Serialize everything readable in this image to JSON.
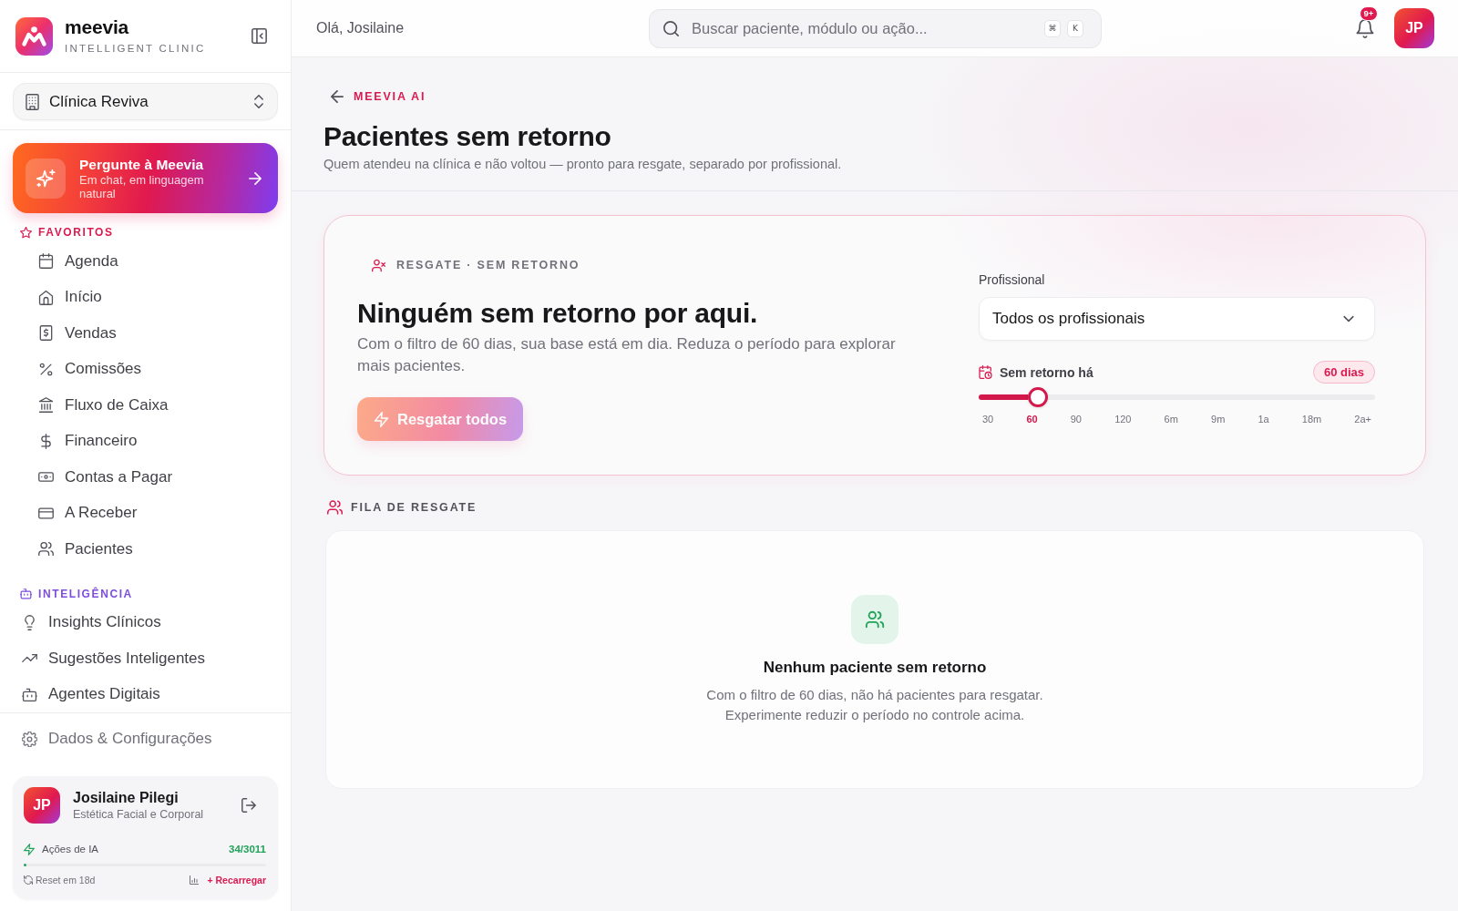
{
  "sidebar": {
    "brand": {
      "name": "meevia",
      "tagline": "INTELLIGENT CLINIC"
    },
    "clinic_selector": {
      "value": "Clínica Reviva"
    },
    "ask_card": {
      "title": "Pergunte à Meevia",
      "subtitle": "Em chat, em linguagem natural"
    },
    "sections": [
      {
        "title": "FAVORITOS",
        "color": "#db1a4f",
        "kind": "indented",
        "items": [
          "Agenda",
          "Início",
          "Vendas",
          "Comissões",
          "Fluxo de Caixa",
          "Financeiro",
          "Contas a Pagar",
          "A Receber",
          "Pacientes"
        ]
      },
      {
        "title": "INTELIGÊNCIA",
        "color": "#7c4ddf",
        "kind": "flat",
        "items": [
          "Insights Clínicos",
          "Sugestões Inteligentes",
          "Agentes Digitais"
        ]
      }
    ],
    "footer_item": "Dados & Configurações",
    "user_card": {
      "initials": "JP",
      "name": "Josilaine Pilegi",
      "role": "Estética Facial e Corporal",
      "usage": {
        "label": "Ações de IA",
        "count": "34/3011",
        "level": 0.011
      },
      "reset": "Reset em 18d",
      "recharge": "+ Recarregar"
    }
  },
  "top_bar": {
    "greeting": "Olá, Josilaine",
    "search": {
      "placeholder": "Buscar paciente, módulo ou ação...",
      "shortcut": [
        "⌘",
        "K"
      ]
    },
    "notification_badge": "9+",
    "avatar": "JP"
  },
  "page_header": {
    "breadcrumb": "MEEVIA AI",
    "title": "Pacientes sem retorno",
    "subtitle": "Quem atendeu na clínica e não voltou — pronto para resgate, separado por profissional."
  },
  "hero": {
    "eyebrow": "RESGATE · SEM RETORNO",
    "heading": "Ninguém sem retorno por aqui.",
    "text": "Com o filtro de 60 dias, sua base está em dia. Reduza o período para explorar mais pacientes.",
    "rescue_button": {
      "label": "Resgatar todos",
      "disabled": true
    },
    "filter": {
      "professional_label": "Profissional",
      "professional_select": {
        "value": "Todos os profissionais"
      },
      "period": {
        "label": "Sem retorno há",
        "badge": "60 dias",
        "level": 0.15,
        "ticks": [
          {
            "label": "30",
            "selected": false
          },
          {
            "label": "60",
            "selected": true
          },
          {
            "label": "90",
            "selected": false
          },
          {
            "label": "120",
            "selected": false
          },
          {
            "label": "6m",
            "selected": false
          },
          {
            "label": "9m",
            "selected": false
          },
          {
            "label": "1a",
            "selected": false
          },
          {
            "label": "18m",
            "selected": false
          },
          {
            "label": "2a+",
            "selected": false
          }
        ]
      }
    }
  },
  "queue": {
    "heading": "FILA DE RESGATE",
    "empty_state": {
      "title": "Nenhum paciente sem retorno",
      "text": "Com o filtro de 60 dias, não há pacientes para resgatar. Experimente reduzir o período no controle acima."
    }
  }
}
